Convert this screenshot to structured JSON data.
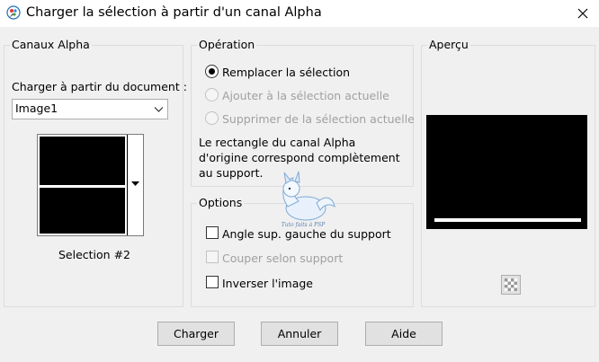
{
  "window": {
    "title": "Charger la sélection à partir d'un canal Alpha",
    "app_icon": "paintshop-pro-icon",
    "close_glyph": "close-icon"
  },
  "alpha_channels": {
    "legend": "Canaux Alpha",
    "load_from_label": "Charger à partir du document :",
    "document_select_value": "Image1",
    "selection_name": "Selection #2"
  },
  "operation": {
    "legend": "Opération",
    "options": [
      {
        "label": "Remplacer la sélection",
        "selected": true,
        "enabled": true
      },
      {
        "label": "Ajouter à la sélection actuelle",
        "selected": false,
        "enabled": false
      },
      {
        "label": "Supprimer de la sélection actuelle",
        "selected": false,
        "enabled": false
      }
    ],
    "info_line1": "Le rectangle du canal Alpha",
    "info_line2": "d'origine correspond complètement",
    "info_line3": "au support."
  },
  "options": {
    "legend": "Options",
    "checkboxes": [
      {
        "label": "Angle sup. gauche du support",
        "checked": false,
        "enabled": true
      },
      {
        "label": "Couper selon support",
        "checked": false,
        "enabled": false
      },
      {
        "label": "Inverser l'image",
        "checked": false,
        "enabled": true
      }
    ]
  },
  "preview": {
    "legend": "Aperçu",
    "button_icon": "checkerboard-icon"
  },
  "buttons": {
    "load": "Charger",
    "cancel": "Annuler",
    "help": "Aide"
  },
  "watermark": {
    "text": "Tuto faits à PSP"
  }
}
